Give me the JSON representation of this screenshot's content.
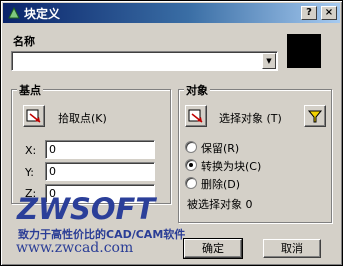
{
  "window": {
    "title": "块定义",
    "minimize": "?",
    "close": "×"
  },
  "name_section": {
    "label": "名称",
    "value": "",
    "preview_color": "#000000"
  },
  "base_point": {
    "group_title": "基点",
    "pick_label": "拾取点",
    "pick_key": "(K)",
    "x_label": "X:",
    "x_value": "0",
    "y_label": "Y:",
    "y_value": "0",
    "z_label": "Z:",
    "z_value": "0"
  },
  "objects": {
    "group_title": "对象",
    "select_label": "选择对象",
    "select_key": "(T)",
    "retain_label": "保留",
    "retain_key": "(R)",
    "convert_label": "转换为块",
    "convert_key": "(C)",
    "delete_label": "删除",
    "delete_key": "(D)",
    "selected_label": "被选择对象",
    "selected_count": "0",
    "selected_option": "convert"
  },
  "watermark": {
    "brand": "ZWSOFT",
    "slogan": "致力于高性价比的CAD/CAM软件",
    "url": "www.zwcad.com"
  },
  "buttons": {
    "ok": "确定",
    "cancel": "取消"
  },
  "colors": {
    "title_bar": "#0a246a",
    "brand": "#2b3f99",
    "face": "#d4d0c8"
  }
}
